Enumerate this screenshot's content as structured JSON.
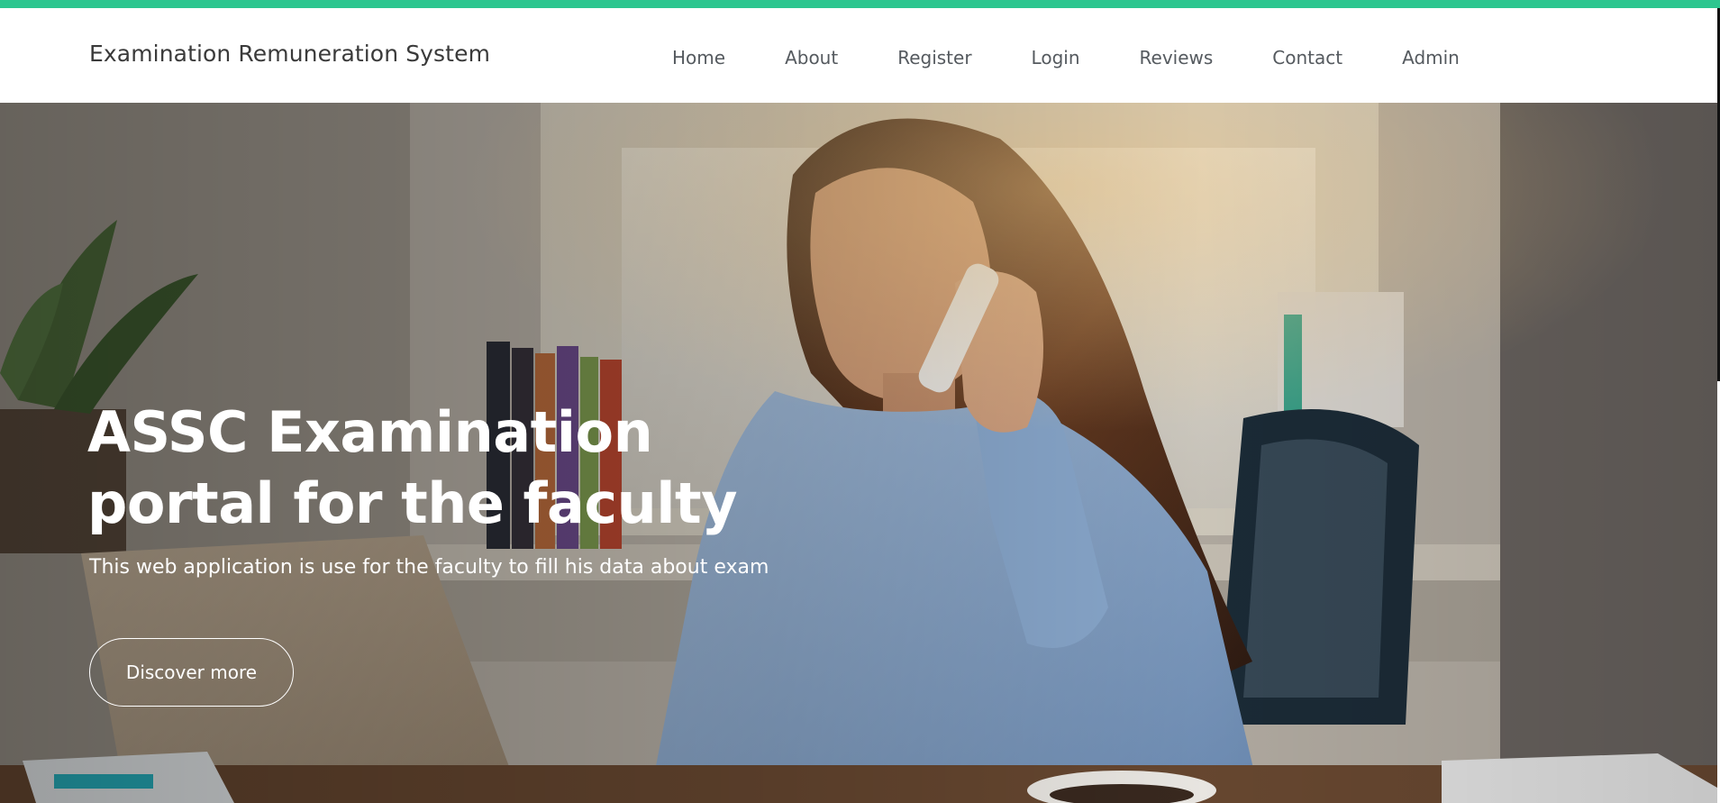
{
  "brand": {
    "name": "Examination Remuneration System"
  },
  "nav": {
    "items": [
      {
        "label": "Home"
      },
      {
        "label": "About"
      },
      {
        "label": "Register"
      },
      {
        "label": "Login"
      },
      {
        "label": "Reviews"
      },
      {
        "label": "Contact"
      },
      {
        "label": "Admin"
      }
    ]
  },
  "hero": {
    "title": "ASSC Examination portal for the faculty",
    "subtitle": "This web application is use for the faculty to fill his data about exam",
    "cta_label": "Discover more",
    "image": "woman-on-phone-at-laptop-photo"
  },
  "colors": {
    "accent": "#2dc68f",
    "nav_text": "#555a5f",
    "brand_text": "#3a3a3a",
    "hero_text": "#ffffff"
  }
}
